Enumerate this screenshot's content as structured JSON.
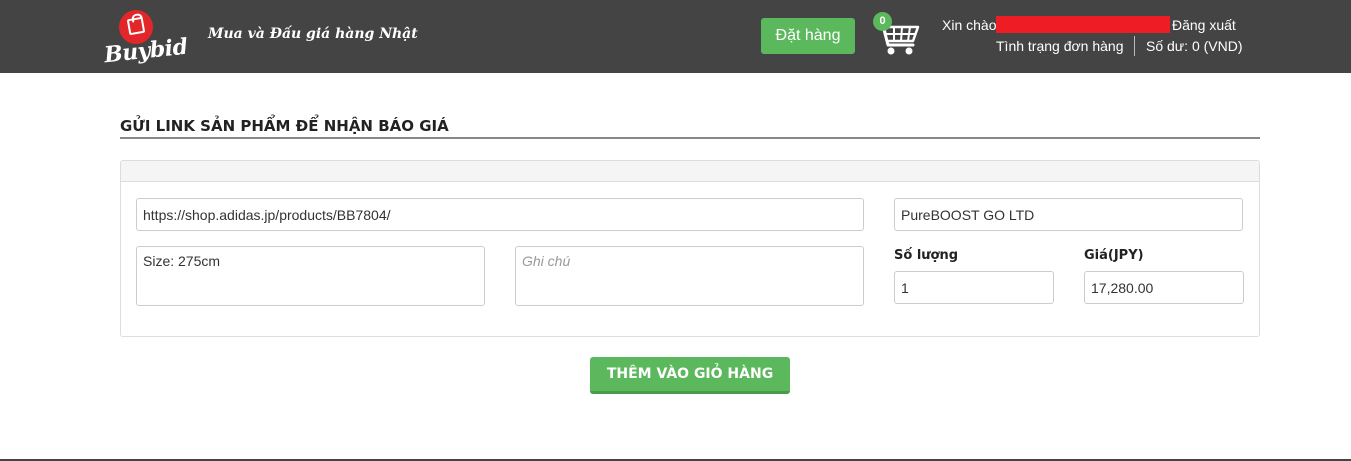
{
  "header": {
    "logo_text": "Buybid",
    "tagline": "Mua và Đấu giá hàng Nhật",
    "order_button": "Đặt hàng",
    "cart_count": "0",
    "greeting": "Xin chào",
    "logout": "Đăng xuất",
    "order_status": "Tình trạng đơn hàng",
    "balance": "Số dư: 0 (VND)",
    "redaction_color": "#ee1c24"
  },
  "main": {
    "section_title": "GỬI LINK SẢN PHẨM ĐỂ NHẬN BÁO GIÁ",
    "form": {
      "link_value": "https://shop.adidas.jp/products/BB7804/",
      "product_name_value": "PureBOOST GO LTD",
      "size_value": "Size: 275cm",
      "note_placeholder": "Ghi chú",
      "quantity_label": "Số lượng",
      "quantity_value": "1",
      "price_label": "Giá(JPY)",
      "price_value": "17,280.00"
    },
    "add_to_cart_button": "THÊM VÀO GIỎ HÀNG"
  },
  "colors": {
    "header_bg": "#444444",
    "accent_green": "#5cb85c",
    "logo_red": "#e32629"
  }
}
